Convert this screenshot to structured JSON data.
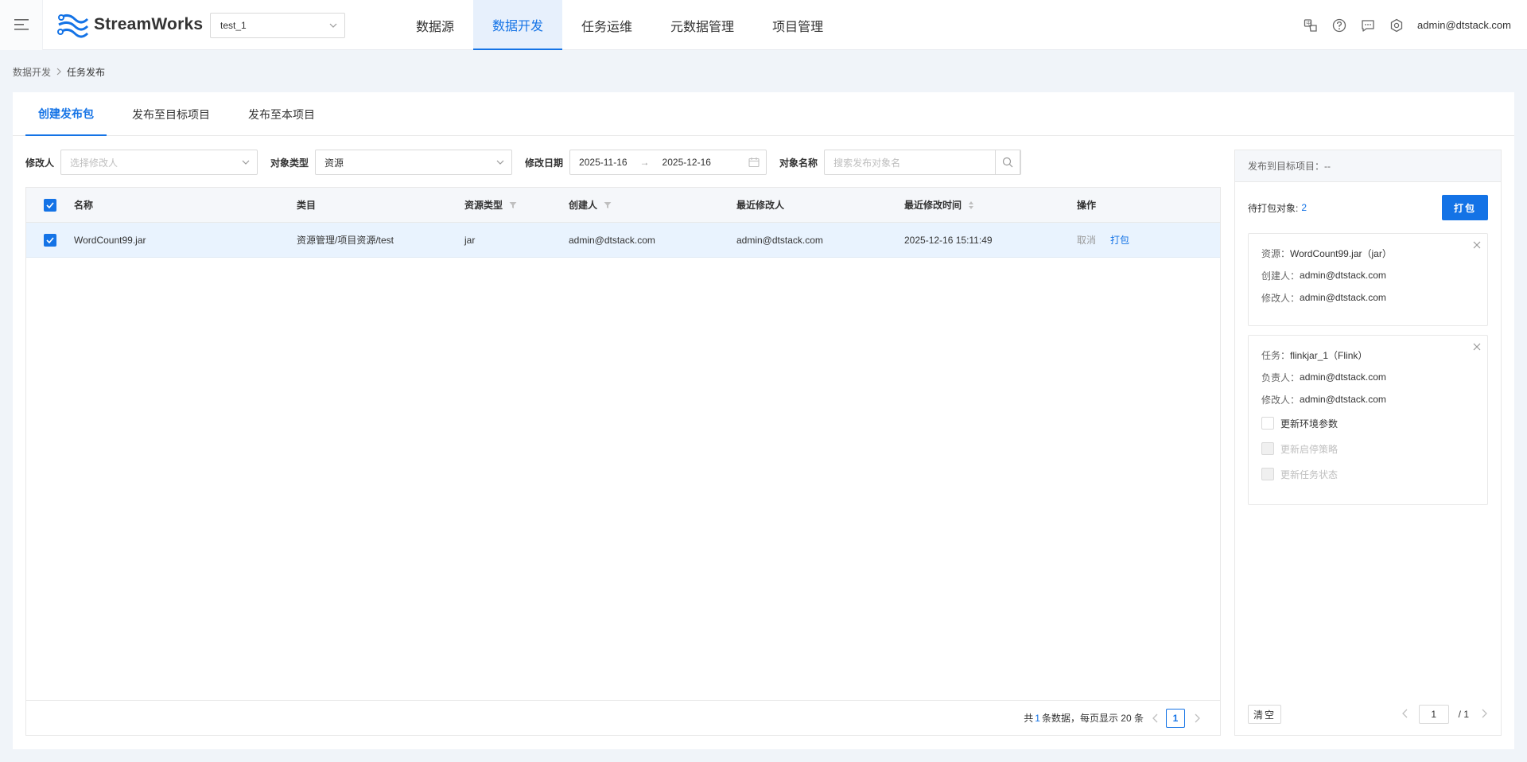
{
  "app": {
    "name": "StreamWorks",
    "project": "test_1",
    "user": "admin@dtstack.com"
  },
  "nav": [
    {
      "label": "数据源"
    },
    {
      "label": "数据开发"
    },
    {
      "label": "任务运维"
    },
    {
      "label": "元数据管理"
    },
    {
      "label": "项目管理"
    }
  ],
  "breadcrumb": {
    "parent": "数据开发",
    "current": "任务发布"
  },
  "tabs": [
    {
      "label": "创建发布包"
    },
    {
      "label": "发布至目标项目"
    },
    {
      "label": "发布至本项目"
    }
  ],
  "filters": {
    "modifier_label": "修改人",
    "modifier_placeholder": "选择修改人",
    "type_label": "对象类型",
    "type_value": "资源",
    "date_label": "修改日期",
    "date_start": "2025-11-16",
    "date_end": "2025-12-16",
    "name_label": "对象名称",
    "name_placeholder": "搜索发布对象名"
  },
  "table": {
    "columns": [
      "名称",
      "类目",
      "资源类型",
      "创建人",
      "最近修改人",
      "最近修改时间",
      "操作"
    ],
    "rows": [
      {
        "name": "WordCount99.jar",
        "category": "资源管理/项目资源/test",
        "resource_type": "jar",
        "creator": "admin@dtstack.com",
        "modifier": "admin@dtstack.com",
        "modified_at": "2025-12-16 15:11:49",
        "op_cancel": "取消",
        "op_pack": "打包"
      }
    ],
    "footer": {
      "prefix": "共",
      "total": "1",
      "suffix": "条数据，每页显示 20 条",
      "page": "1"
    }
  },
  "side": {
    "header": "发布到目标项目：--",
    "pending_label": "待打包对象:",
    "pending_count": "2",
    "pack_button": "打包",
    "items": [
      {
        "lines": [
          {
            "k": "资源：",
            "v": "WordCount99.jar（jar）"
          },
          {
            "k": "创建人：",
            "v": "admin@dtstack.com"
          },
          {
            "k": "修改人：",
            "v": "admin@dtstack.com"
          }
        ]
      },
      {
        "lines": [
          {
            "k": "任务：",
            "v": "flinkjar_1（Flink）"
          },
          {
            "k": "负责人：",
            "v": "admin@dtstack.com"
          },
          {
            "k": "修改人：",
            "v": "admin@dtstack.com"
          }
        ],
        "options": [
          "更新环境参数",
          "更新启停策略",
          "更新任务状态"
        ]
      }
    ],
    "clear_button": "清空",
    "pager": {
      "current": "1",
      "total": "/ 1"
    }
  },
  "colors": {
    "primary": "#1473e6",
    "row_selected": "#e9f3fe",
    "page_bg": "#f0f4f9"
  }
}
